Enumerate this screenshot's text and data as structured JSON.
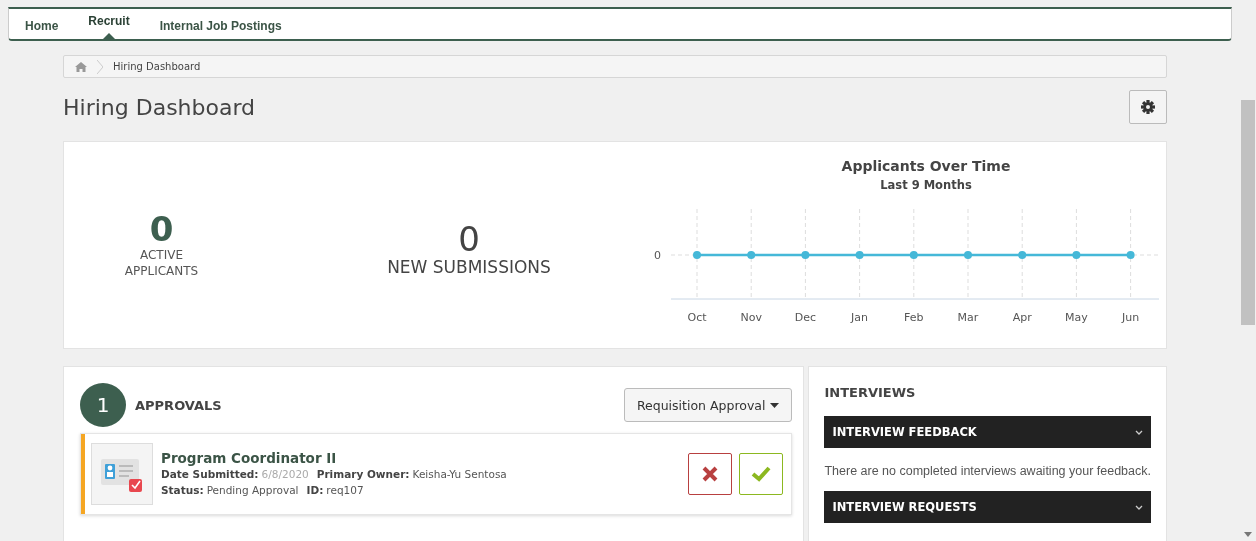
{
  "nav": {
    "tabs": [
      {
        "label": "Home",
        "selected": false
      },
      {
        "label": "Recruit",
        "selected": true
      },
      {
        "label": "Internal Job Postings",
        "selected": false
      }
    ]
  },
  "breadcrumb": {
    "items": [
      "Hiring Dashboard"
    ]
  },
  "page_title": "Hiring Dashboard",
  "stats": [
    {
      "value": "0",
      "label": "ACTIVE APPLICANTS",
      "kind": "primary"
    },
    {
      "value": "0",
      "label": "NEW SUBMISSIONS",
      "kind": "secondary"
    }
  ],
  "chart": {
    "title": "Applicants Over Time",
    "subtitle": "Last 9 Months",
    "x_labels": [
      "Oct",
      "Nov",
      "Dec",
      "Jan",
      "Feb",
      "Mar",
      "Apr",
      "May",
      "Jun"
    ],
    "y_axis_label": "0"
  },
  "approvals": {
    "count": "1",
    "title": "APPROVALS",
    "filter": "Requisition Approval",
    "items": [
      {
        "title": "Program Coordinator II",
        "color": "#f5a623",
        "lines": [
          [
            {
              "label": "Date Submitted:",
              "value": "6/8/2020",
              "muted": true
            },
            {
              "label": "Primary Owner:",
              "value": "Keisha-Yu Sentosa",
              "muted": false
            }
          ],
          [
            {
              "label": "Status:",
              "value": "Pending Approval",
              "muted": false
            },
            {
              "label": "ID:",
              "value": "req107",
              "muted": false
            }
          ]
        ]
      }
    ]
  },
  "interviews": {
    "title": "INTERVIEWS",
    "sections": [
      {
        "title": "INTERVIEW FEEDBACK",
        "message": "There are no completed interviews awaiting your feedback."
      },
      {
        "title": "INTERVIEW REQUESTS"
      }
    ]
  }
}
